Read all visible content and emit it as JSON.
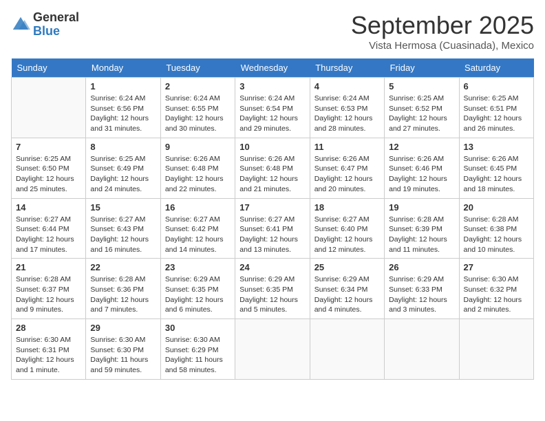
{
  "logo": {
    "general": "General",
    "blue": "Blue"
  },
  "title": "September 2025",
  "subtitle": "Vista Hermosa (Cuasinada), Mexico",
  "days_of_week": [
    "Sunday",
    "Monday",
    "Tuesday",
    "Wednesday",
    "Thursday",
    "Friday",
    "Saturday"
  ],
  "weeks": [
    [
      {
        "day": "",
        "info": ""
      },
      {
        "day": "1",
        "info": "Sunrise: 6:24 AM\nSunset: 6:56 PM\nDaylight: 12 hours\nand 31 minutes."
      },
      {
        "day": "2",
        "info": "Sunrise: 6:24 AM\nSunset: 6:55 PM\nDaylight: 12 hours\nand 30 minutes."
      },
      {
        "day": "3",
        "info": "Sunrise: 6:24 AM\nSunset: 6:54 PM\nDaylight: 12 hours\nand 29 minutes."
      },
      {
        "day": "4",
        "info": "Sunrise: 6:24 AM\nSunset: 6:53 PM\nDaylight: 12 hours\nand 28 minutes."
      },
      {
        "day": "5",
        "info": "Sunrise: 6:25 AM\nSunset: 6:52 PM\nDaylight: 12 hours\nand 27 minutes."
      },
      {
        "day": "6",
        "info": "Sunrise: 6:25 AM\nSunset: 6:51 PM\nDaylight: 12 hours\nand 26 minutes."
      }
    ],
    [
      {
        "day": "7",
        "info": "Sunrise: 6:25 AM\nSunset: 6:50 PM\nDaylight: 12 hours\nand 25 minutes."
      },
      {
        "day": "8",
        "info": "Sunrise: 6:25 AM\nSunset: 6:49 PM\nDaylight: 12 hours\nand 24 minutes."
      },
      {
        "day": "9",
        "info": "Sunrise: 6:26 AM\nSunset: 6:48 PM\nDaylight: 12 hours\nand 22 minutes."
      },
      {
        "day": "10",
        "info": "Sunrise: 6:26 AM\nSunset: 6:48 PM\nDaylight: 12 hours\nand 21 minutes."
      },
      {
        "day": "11",
        "info": "Sunrise: 6:26 AM\nSunset: 6:47 PM\nDaylight: 12 hours\nand 20 minutes."
      },
      {
        "day": "12",
        "info": "Sunrise: 6:26 AM\nSunset: 6:46 PM\nDaylight: 12 hours\nand 19 minutes."
      },
      {
        "day": "13",
        "info": "Sunrise: 6:26 AM\nSunset: 6:45 PM\nDaylight: 12 hours\nand 18 minutes."
      }
    ],
    [
      {
        "day": "14",
        "info": "Sunrise: 6:27 AM\nSunset: 6:44 PM\nDaylight: 12 hours\nand 17 minutes."
      },
      {
        "day": "15",
        "info": "Sunrise: 6:27 AM\nSunset: 6:43 PM\nDaylight: 12 hours\nand 16 minutes."
      },
      {
        "day": "16",
        "info": "Sunrise: 6:27 AM\nSunset: 6:42 PM\nDaylight: 12 hours\nand 14 minutes."
      },
      {
        "day": "17",
        "info": "Sunrise: 6:27 AM\nSunset: 6:41 PM\nDaylight: 12 hours\nand 13 minutes."
      },
      {
        "day": "18",
        "info": "Sunrise: 6:27 AM\nSunset: 6:40 PM\nDaylight: 12 hours\nand 12 minutes."
      },
      {
        "day": "19",
        "info": "Sunrise: 6:28 AM\nSunset: 6:39 PM\nDaylight: 12 hours\nand 11 minutes."
      },
      {
        "day": "20",
        "info": "Sunrise: 6:28 AM\nSunset: 6:38 PM\nDaylight: 12 hours\nand 10 minutes."
      }
    ],
    [
      {
        "day": "21",
        "info": "Sunrise: 6:28 AM\nSunset: 6:37 PM\nDaylight: 12 hours\nand 9 minutes."
      },
      {
        "day": "22",
        "info": "Sunrise: 6:28 AM\nSunset: 6:36 PM\nDaylight: 12 hours\nand 7 minutes."
      },
      {
        "day": "23",
        "info": "Sunrise: 6:29 AM\nSunset: 6:35 PM\nDaylight: 12 hours\nand 6 minutes."
      },
      {
        "day": "24",
        "info": "Sunrise: 6:29 AM\nSunset: 6:35 PM\nDaylight: 12 hours\nand 5 minutes."
      },
      {
        "day": "25",
        "info": "Sunrise: 6:29 AM\nSunset: 6:34 PM\nDaylight: 12 hours\nand 4 minutes."
      },
      {
        "day": "26",
        "info": "Sunrise: 6:29 AM\nSunset: 6:33 PM\nDaylight: 12 hours\nand 3 minutes."
      },
      {
        "day": "27",
        "info": "Sunrise: 6:30 AM\nSunset: 6:32 PM\nDaylight: 12 hours\nand 2 minutes."
      }
    ],
    [
      {
        "day": "28",
        "info": "Sunrise: 6:30 AM\nSunset: 6:31 PM\nDaylight: 12 hours\nand 1 minute."
      },
      {
        "day": "29",
        "info": "Sunrise: 6:30 AM\nSunset: 6:30 PM\nDaylight: 11 hours\nand 59 minutes."
      },
      {
        "day": "30",
        "info": "Sunrise: 6:30 AM\nSunset: 6:29 PM\nDaylight: 11 hours\nand 58 minutes."
      },
      {
        "day": "",
        "info": ""
      },
      {
        "day": "",
        "info": ""
      },
      {
        "day": "",
        "info": ""
      },
      {
        "day": "",
        "info": ""
      }
    ]
  ]
}
